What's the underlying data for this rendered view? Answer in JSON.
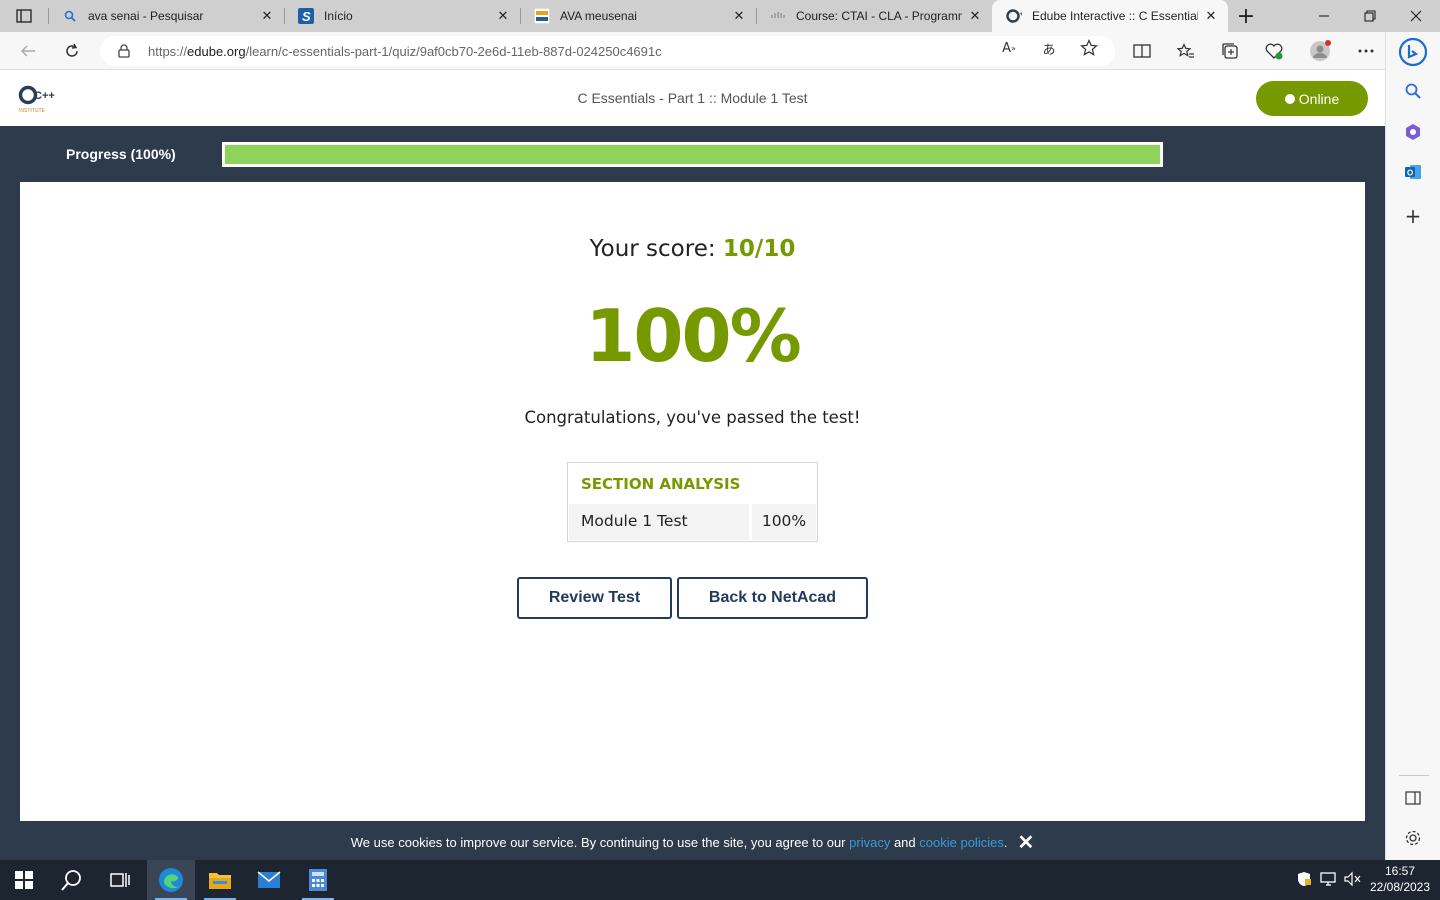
{
  "browser": {
    "tabs": [
      {
        "title": "ava senai - Pesquisar",
        "icon": "search-favicon"
      },
      {
        "title": "Início",
        "icon": "s-favicon"
      },
      {
        "title": "AVA meusenai",
        "icon": "meusenai-favicon"
      },
      {
        "title": "Course: CTAI - CLA - Programmi",
        "icon": "cisco-favicon"
      },
      {
        "title": "Edube Interactive :: C Essentials",
        "icon": "cpp-institute-favicon"
      }
    ],
    "active_tab": 4,
    "url_prefix": "https://",
    "url_domain": "edube.org",
    "url_path": "/learn/c-essentials-part-1/quiz/9af0cb70-2e6d-11eb-887d-024250c4691c"
  },
  "header": {
    "logo_text": "C++",
    "logo_sub": "INSTITUTE",
    "page_title": "C Essentials - Part 1 :: Module 1 Test",
    "status_label": "Online"
  },
  "progress": {
    "label": "Progress (100%)",
    "value": 1.0
  },
  "result": {
    "score_label": "Your score:",
    "score_value": "10/10",
    "percent": "100%",
    "message": "Congratulations, you've passed the test!"
  },
  "section_analysis": {
    "heading": "SECTION ANALYSIS",
    "rows": [
      {
        "name": "Module 1 Test",
        "value": "100%"
      }
    ]
  },
  "actions": {
    "review": "Review Test",
    "back": "Back to NetAcad"
  },
  "cookie": {
    "text_before": "We use cookies to improve our service. By continuing to use the site, you agree to our",
    "link_privacy": "privacy",
    "and": "and",
    "link_cookies": "cookie policies",
    "end": ".",
    "close": "✕"
  },
  "taskbar": {
    "time": "16:57",
    "date": "22/08/2023"
  },
  "colors": {
    "accent_green": "#779900",
    "progress_fill": "#8fd45a",
    "dark_bg": "#2d3b4d",
    "button_navy": "#233a5e"
  }
}
